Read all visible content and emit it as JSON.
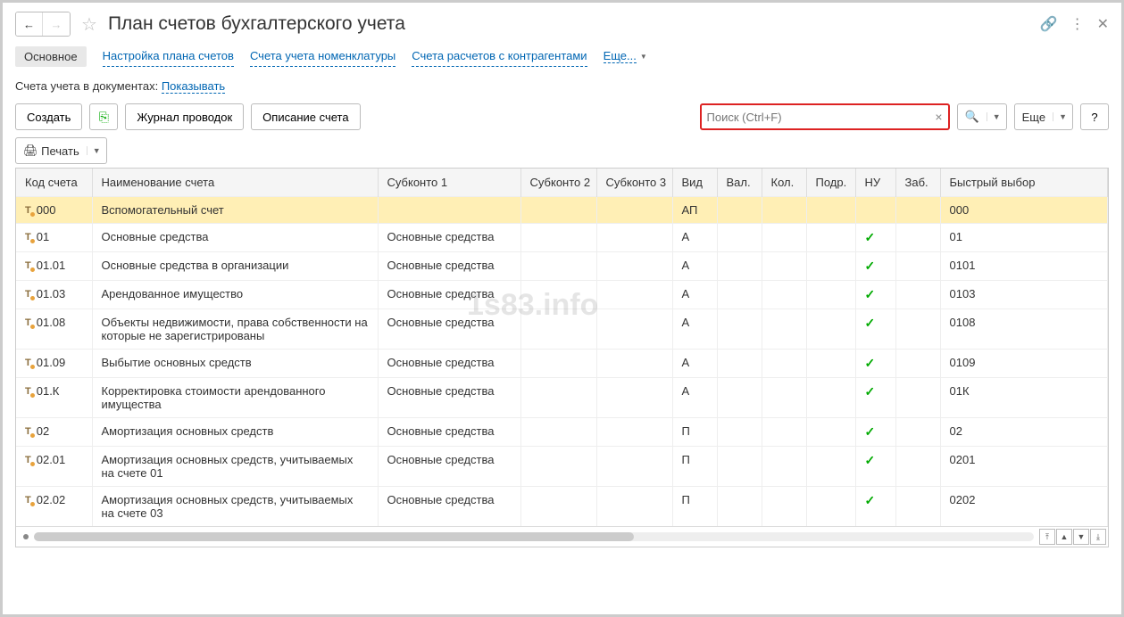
{
  "title": "План счетов бухгалтерского учета",
  "nav": {
    "tabs": [
      "Основное",
      "Настройка плана счетов",
      "Счета учета номенклатуры",
      "Счета расчетов с контрагентами"
    ],
    "more": "Еще..."
  },
  "doc_line": {
    "label": "Счета учета в документах:",
    "link": "Показывать"
  },
  "toolbar": {
    "create": "Создать",
    "journal": "Журнал проводок",
    "describe": "Описание счета",
    "print": "Печать",
    "more": "Еще",
    "help": "?",
    "search_placeholder": "Поиск (Ctrl+F)"
  },
  "columns": [
    "Код счета",
    "Наименование счета",
    "Субконто 1",
    "Субконто 2",
    "Субконто 3",
    "Вид",
    "Вал.",
    "Кол.",
    "Подр.",
    "НУ",
    "Заб.",
    "Быстрый выбор"
  ],
  "rows": [
    {
      "code": "000",
      "name": "Вспомогательный счет",
      "sub1": "",
      "vid": "АП",
      "nu": false,
      "quick": "000",
      "selected": true
    },
    {
      "code": "01",
      "name": "Основные средства",
      "sub1": "Основные средства",
      "vid": "А",
      "nu": true,
      "quick": "01"
    },
    {
      "code": "01.01",
      "name": "Основные средства в организации",
      "sub1": "Основные средства",
      "vid": "А",
      "nu": true,
      "quick": "0101"
    },
    {
      "code": "01.03",
      "name": "Арендованное имущество",
      "sub1": "Основные средства",
      "vid": "А",
      "nu": true,
      "quick": "0103"
    },
    {
      "code": "01.08",
      "name": "Объекты недвижимости, права собственности на которые не зарегистрированы",
      "sub1": "Основные средства",
      "vid": "А",
      "nu": true,
      "quick": "0108"
    },
    {
      "code": "01.09",
      "name": "Выбытие основных средств",
      "sub1": "Основные средства",
      "vid": "А",
      "nu": true,
      "quick": "0109"
    },
    {
      "code": "01.К",
      "name": "Корректировка стоимости арендованного имущества",
      "sub1": "Основные средства",
      "vid": "А",
      "nu": true,
      "quick": "01К"
    },
    {
      "code": "02",
      "name": "Амортизация основных средств",
      "sub1": "Основные средства",
      "vid": "П",
      "nu": true,
      "quick": "02"
    },
    {
      "code": "02.01",
      "name": "Амортизация основных средств, учитываемых на счете 01",
      "sub1": "Основные средства",
      "vid": "П",
      "nu": true,
      "quick": "0201"
    },
    {
      "code": "02.02",
      "name": "Амортизация основных средств, учитываемых на счете 03",
      "sub1": "Основные средства",
      "vid": "П",
      "nu": true,
      "quick": "0202"
    }
  ],
  "watermark": "1s83.info"
}
